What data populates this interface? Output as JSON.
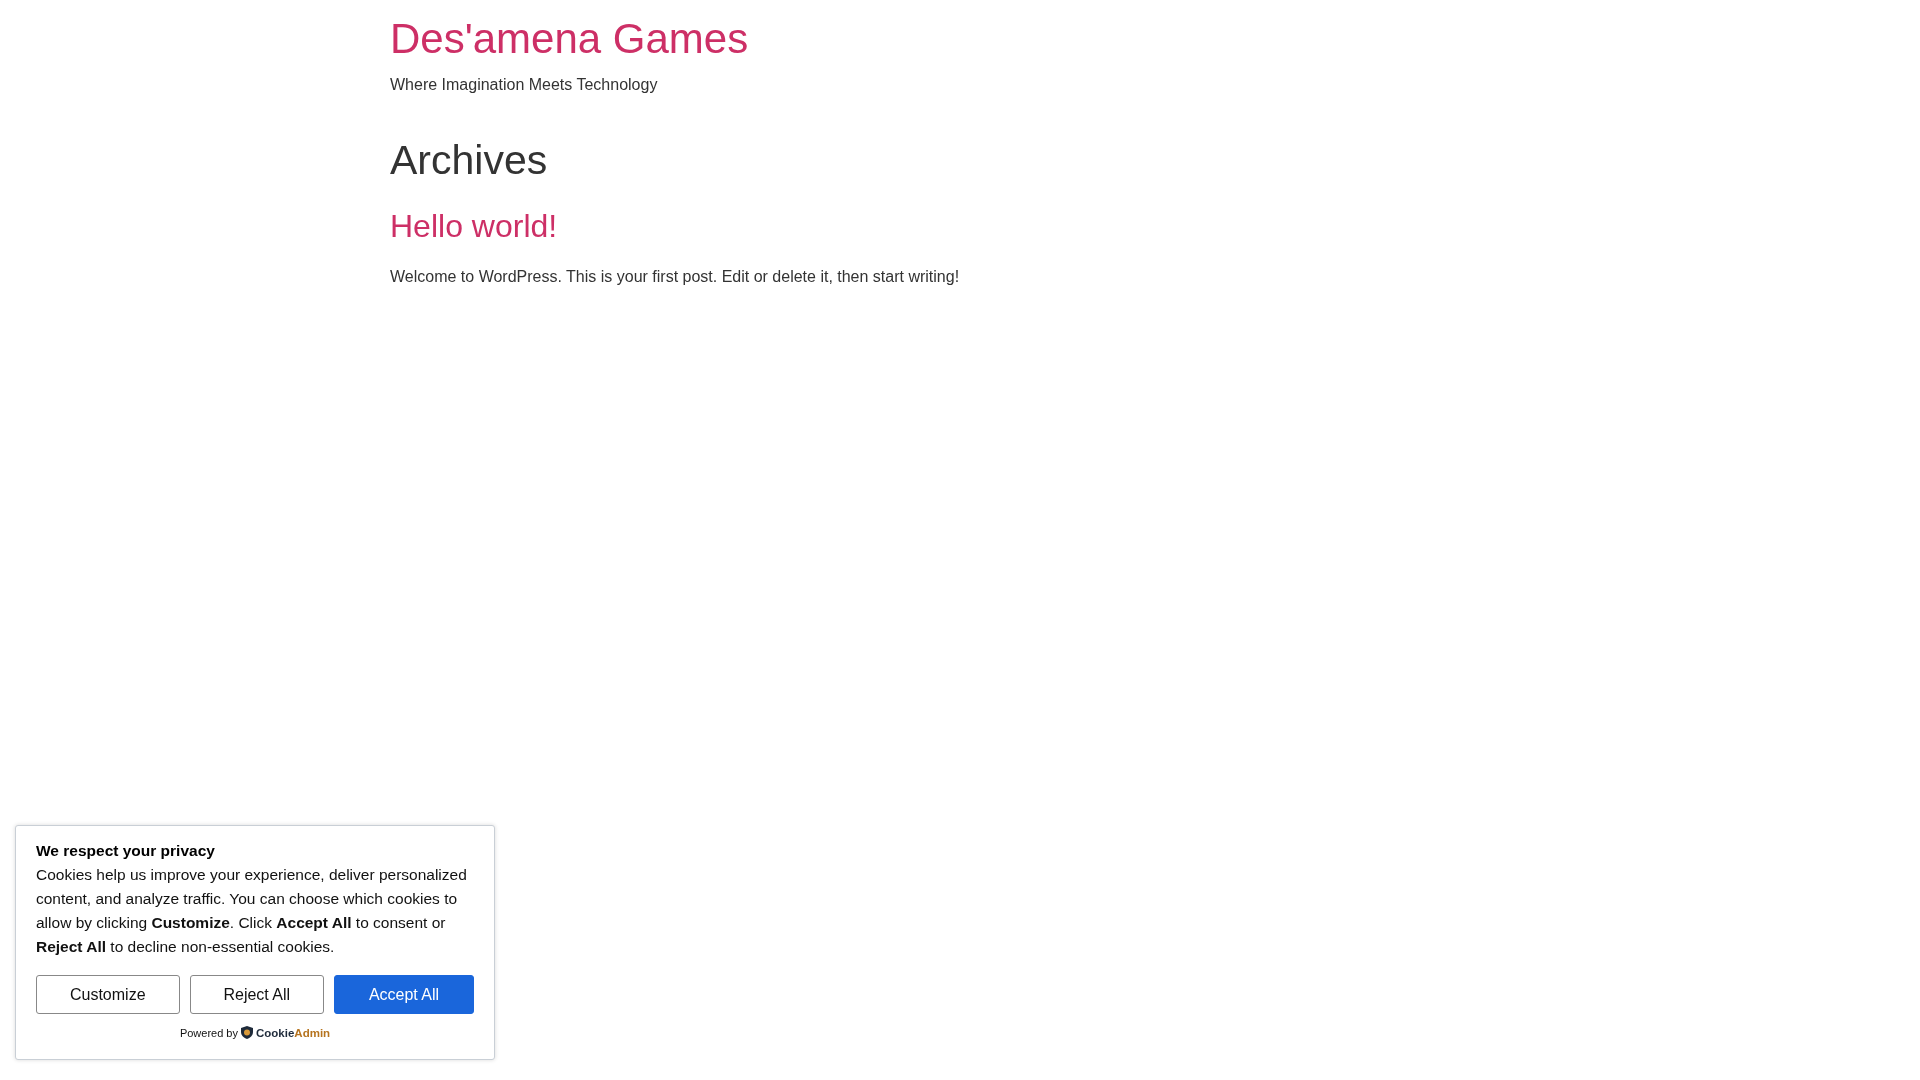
{
  "site": {
    "title": "Des'amena Games",
    "tagline": "Where Imagination Meets Technology"
  },
  "archive": {
    "heading": "Archives",
    "posts": [
      {
        "title": "Hello world!",
        "excerpt": "Welcome to WordPress. This is your first post. Edit or delete it, then start writing!"
      }
    ]
  },
  "cookie_banner": {
    "title": "We respect your privacy",
    "text": "Cookies help us improve your experience, deliver personalized content, and analyze traffic. You can choose which cookies to allow by clicking **Customize**. Click **Accept All** to consent or **Reject All** to decline non-essential cookies.",
    "buttons": [
      {
        "label": "Customize",
        "kind": "outline"
      },
      {
        "label": "Reject All",
        "kind": "outline"
      },
      {
        "label": "Accept All",
        "kind": "primary"
      }
    ],
    "powered_by": "Powered by",
    "brand": {
      "first": "Cookie",
      "second": "Admin"
    }
  }
}
